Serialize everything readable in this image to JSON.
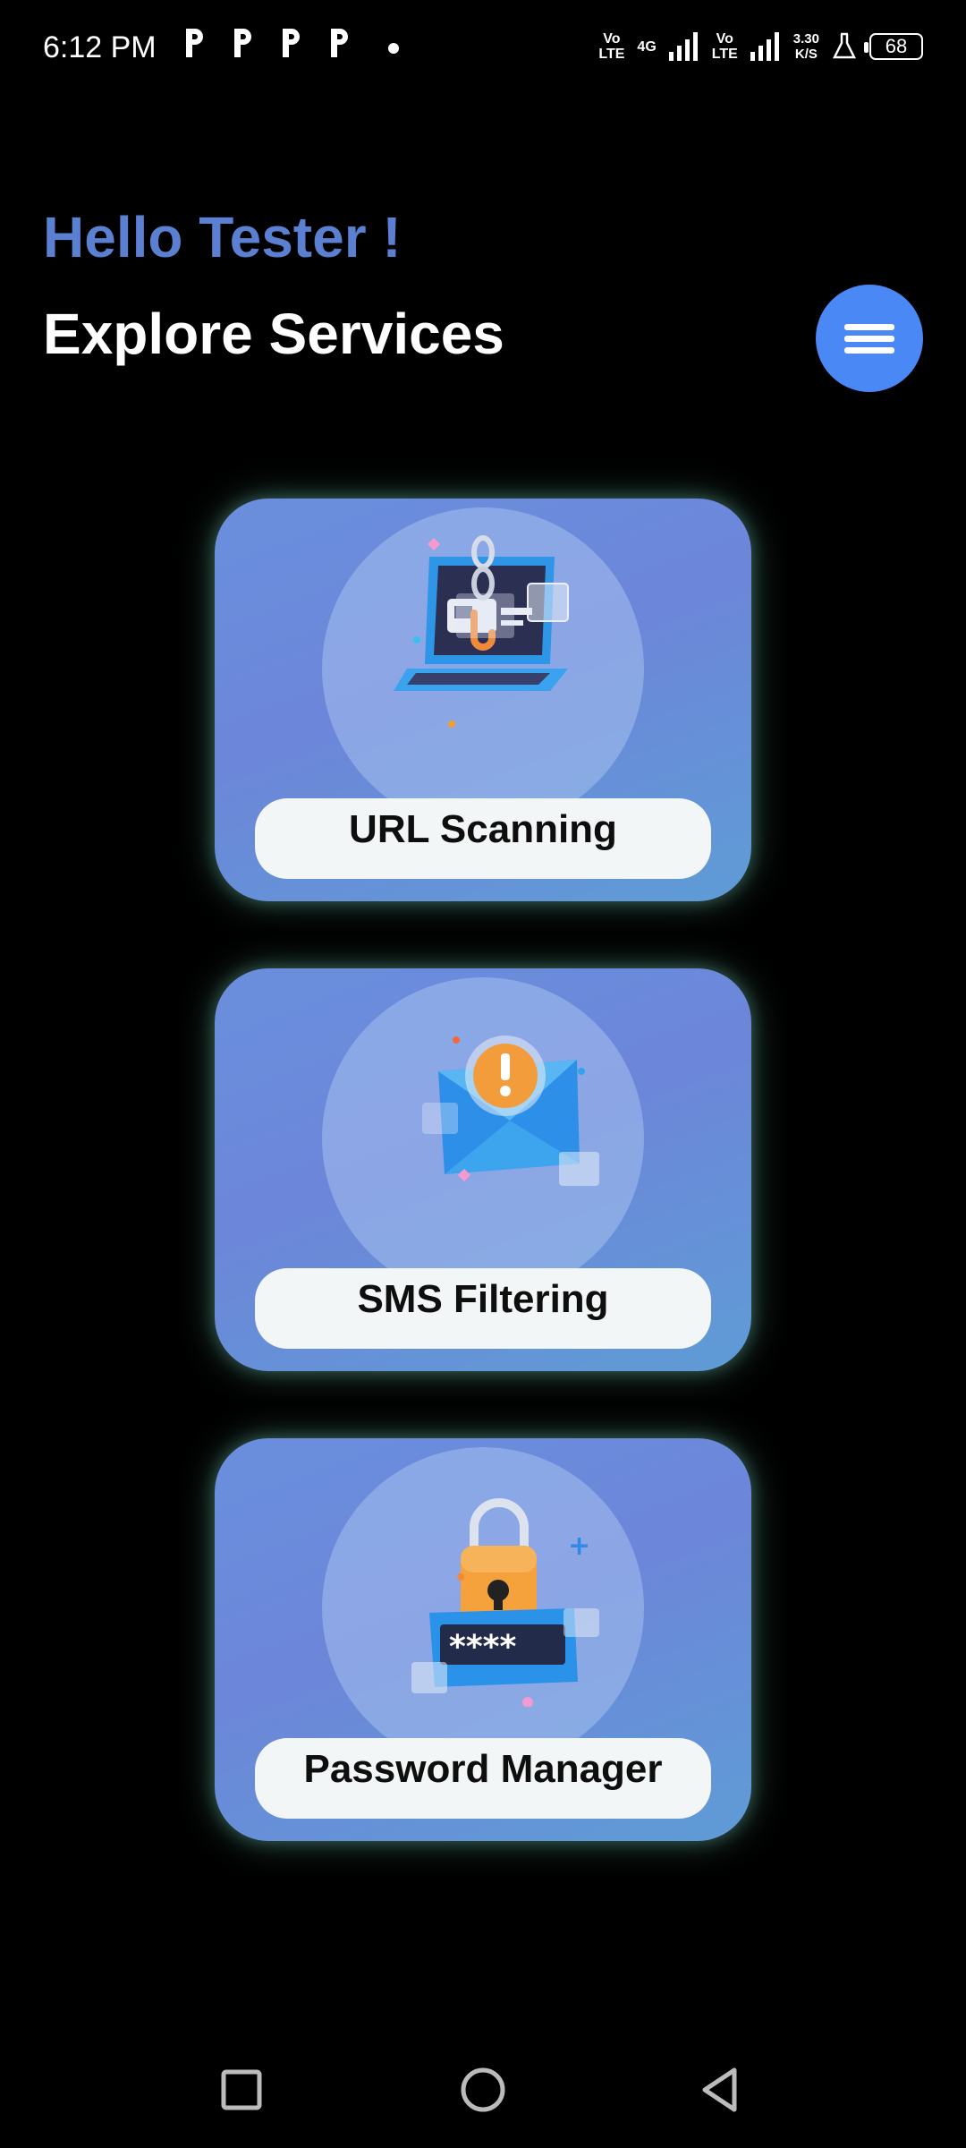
{
  "status_bar": {
    "time": "6:12 PM",
    "notification_icons": [
      "p-notification-icon",
      "p-notification-icon",
      "p-notification-icon",
      "p-notification-icon"
    ],
    "volte1": "Vo\nLTE",
    "network": "4G",
    "volte2": "Vo\nLTE",
    "speed_value": "3.30",
    "speed_unit": "K/S",
    "battery": "68"
  },
  "header": {
    "greeting": "Hello Tester !",
    "title": "Explore Services",
    "menu_icon": "hamburger-menu-icon"
  },
  "services": [
    {
      "label": "URL Scanning",
      "icon": "laptop-link-icon"
    },
    {
      "label": "SMS Filtering",
      "icon": "mail-warning-icon"
    },
    {
      "label": "Password Manager",
      "icon": "padlock-password-icon"
    }
  ],
  "nav": {
    "recent": "recent-apps-icon",
    "home": "home-icon",
    "back": "back-icon"
  },
  "colors": {
    "greeting": "#5b7fd1",
    "menu_button": "#4a88f5",
    "card_gradient_start": "#6a8fdd",
    "card_gradient_end": "#5f9cd6",
    "label_box": "#f3f6f6"
  }
}
